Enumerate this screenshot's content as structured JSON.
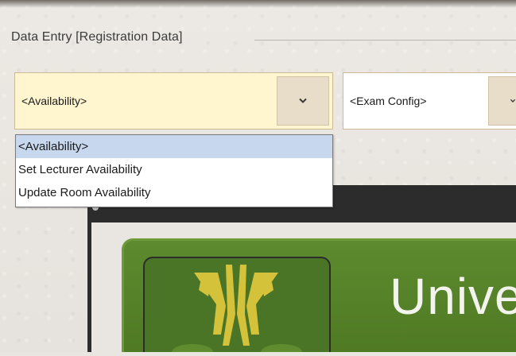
{
  "group": {
    "title": "Data Entry [Registration Data]"
  },
  "availability_combo": {
    "value": "<Availability>",
    "icon": "chevron-down-icon",
    "background": "#fff6cf",
    "options": [
      "<Availability>",
      "Set Lecturer Availability",
      "Update Room Availability"
    ],
    "selected_index": 0
  },
  "exam_combo": {
    "value": "<Exam Config>",
    "icon": "chevron-down-icon"
  },
  "banner": {
    "text": "Unive",
    "logo_icon": "university-crest-icon",
    "background": "#5d8a2e",
    "logo_color": "#d4c23b"
  }
}
